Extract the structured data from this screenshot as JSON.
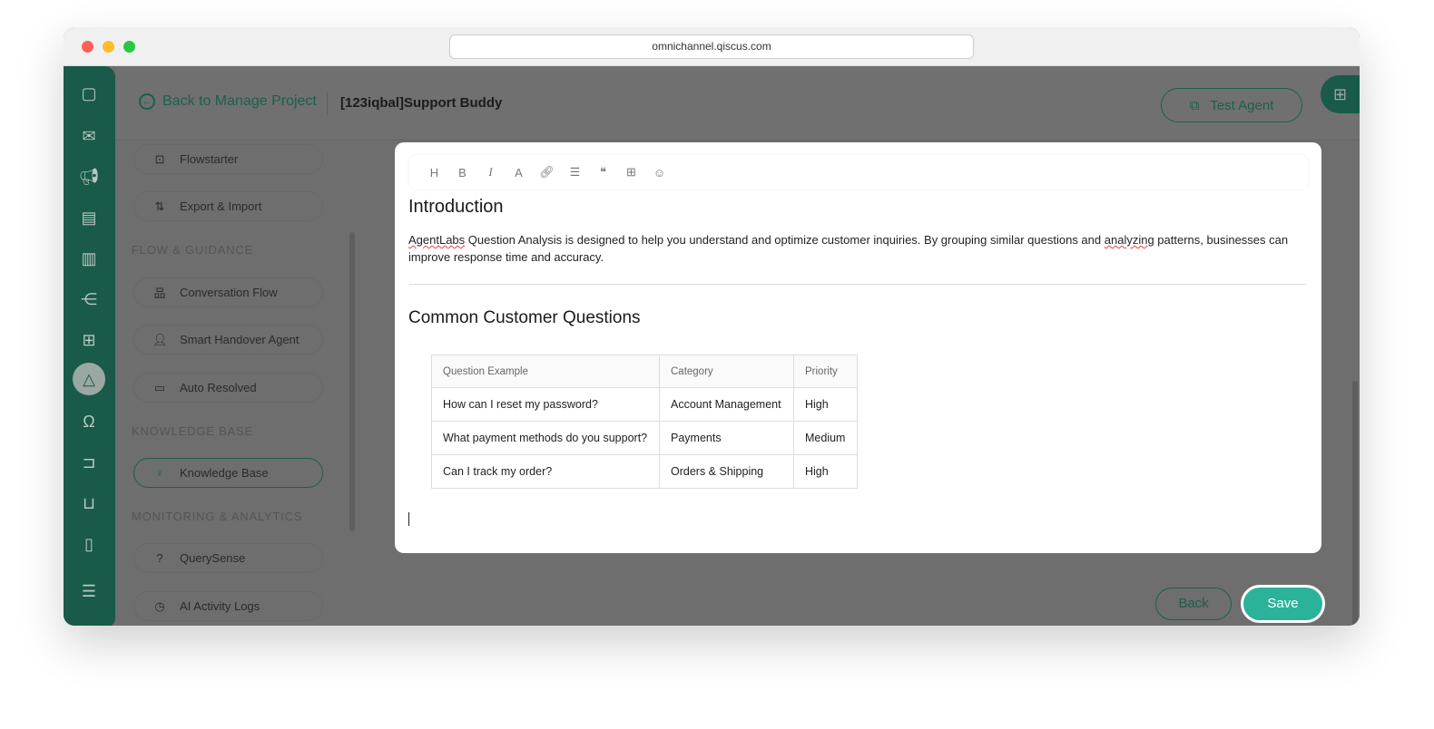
{
  "browser": {
    "url": "omnichannel.qiscus.com"
  },
  "header": {
    "back_label": "Back to Manage Project",
    "project_title": "[123iqbal]Support Buddy",
    "test_agent_label": "Test Agent"
  },
  "sidebar": {
    "items": [
      {
        "label": "Flowstarter"
      },
      {
        "label": "Export & Import"
      },
      {
        "label": "Conversation Flow"
      },
      {
        "label": "Smart Handover Agent"
      },
      {
        "label": "Auto Resolved"
      },
      {
        "label": "Knowledge Base"
      },
      {
        "label": "QuerySense"
      },
      {
        "label": "AI Activity Logs"
      }
    ],
    "sections": [
      "FLOW & GUIDANCE",
      "KNOWLEDGE BASE",
      "MONITORING & ANALYTICS"
    ]
  },
  "editor": {
    "toolbar": [
      "H",
      "B",
      "I",
      "A",
      "link",
      "list",
      "quote",
      "table",
      "emoji"
    ],
    "intro_heading": "Introduction",
    "intro_word1": "AgentLabs",
    "intro_mid": " Question Analysis is designed to help you understand and optimize customer inquiries. By grouping similar questions and ",
    "intro_word2": "analyzing",
    "intro_end": " patterns, businesses can improve response time and accuracy.",
    "questions_heading": "Common Customer Questions",
    "table": {
      "headers": [
        "Question Example",
        "Category",
        "Priority"
      ],
      "rows": [
        [
          "How can I reset my password?",
          "Account Management",
          "High"
        ],
        [
          "What payment methods do you support?",
          "Payments",
          "Medium"
        ],
        [
          "Can I track my order?",
          "Orders & Shipping",
          "High"
        ]
      ]
    }
  },
  "footer": {
    "back_label": "Back",
    "save_label": "Save"
  },
  "colors": {
    "brand": "#195a4a",
    "accent": "#2bb39a"
  }
}
